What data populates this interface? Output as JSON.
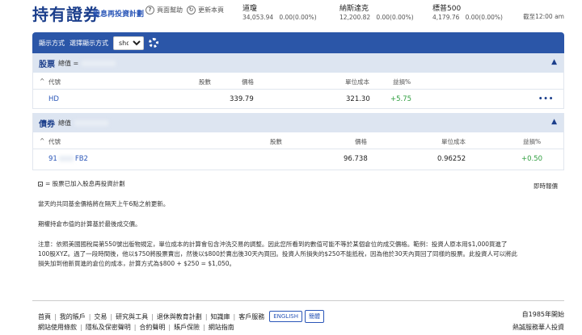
{
  "header": {
    "title": "持有證券",
    "subtitle": "股息再投資計劃",
    "help_label": "頁面幫助",
    "help_icon": "?",
    "refresh_label": "更新本頁",
    "refresh_icon": "↻",
    "indices": [
      {
        "name": "道瓊",
        "value": "34,053.94",
        "change": "0.00(0.00%)"
      },
      {
        "name": "納斯達克",
        "value": "12,200.82",
        "change": "0.00(0.00%)"
      },
      {
        "name": "標普500",
        "value": "4,179.76",
        "change": "0.00(0.00%)"
      }
    ],
    "as_of": "截至12:00 am"
  },
  "toolbar": {
    "display_label": "顯示方式",
    "select_label": "選擇顯示方式",
    "select_value": "show"
  },
  "stocks": {
    "title": "股票",
    "total_label": "總值 =",
    "columns": {
      "symbol": "代號",
      "qty": "股數",
      "price": "價格",
      "unit_cost": "單位成本",
      "gain": "益損%"
    },
    "rows": [
      {
        "symbol": "HD",
        "qty": "",
        "price": "339.79",
        "unit_cost": "321.30",
        "gain": "+5.75"
      }
    ],
    "more": "•••"
  },
  "bonds": {
    "title": "債券",
    "total_label": "總值",
    "columns": {
      "symbol": "代號",
      "qty": "股數",
      "price": "價格",
      "unit_cost": "單位成本",
      "gain": "益損%"
    },
    "rows": [
      {
        "symbol": "91",
        "symbol_suffix": "FB2",
        "price": "96.738",
        "unit_cost": "0.96252",
        "gain": "+0.50"
      }
    ]
  },
  "notes": {
    "legend": "= 股票已加入股息再投資計劃",
    "realtime": "即時報價",
    "fund_note": "當天的共同基金價格將在隔天上午6點之前更新。",
    "market_value_note": "期權持倉市值的計算基於最後成交價。",
    "disclaimer_1": "注意：依照美國國稅局第550號出版物規定，單位成本的計算會包含沖洗交易的調整。因此您所看到的數值可能不等於某個倉位的成交價格。範例：投資人原本用$1,000買進了",
    "disclaimer_2": "100股XYZ。過了一段時間後，他以$750將股票賣出，然後以$800於賣出後30天內買回。投資人所損失的$250不能抵稅，因為他於30天內買回了同樣的股票。此投資人可以將此",
    "disclaimer_3": "損失加到他新買進的倉位的成本，計算方式為$800 + $250 = $1,050。"
  },
  "footer": {
    "row1": [
      "首頁",
      "我的賬戶",
      "交易",
      "研究與工具",
      "退休與教育計劃",
      "知識庫",
      "客戶服務"
    ],
    "lang_en": "ENGLISH",
    "lang_zh": "簡體",
    "row2": [
      "網站使用條款",
      "隱私及保密聲明",
      "合約聲明",
      "賬戶保險",
      "網站指南"
    ],
    "since": "自1985年開始",
    "tagline": "熱誠服務華人投資"
  },
  "colors": {
    "brand": "#1c3f8c",
    "bar": "#2b56a8",
    "gain": "#2f9e3f"
  }
}
